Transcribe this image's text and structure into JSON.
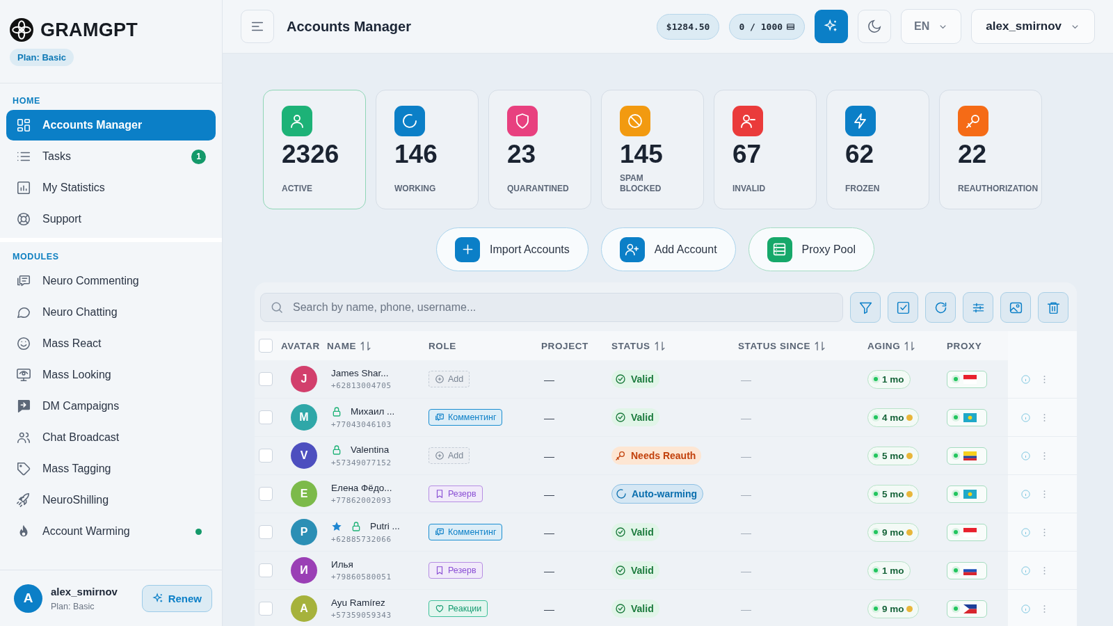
{
  "sidebar": {
    "logo": "GRAMGPT",
    "plan_badge": "Plan: Basic",
    "sections": [
      {
        "title": "HOME",
        "items": [
          {
            "label": "Accounts Manager",
            "kind": "grid",
            "selected": true
          },
          {
            "label": "Tasks",
            "kind": "list",
            "selected": false,
            "badge": "1"
          },
          {
            "label": "My Statistics",
            "kind": "chart",
            "selected": false
          },
          {
            "label": "Support",
            "kind": "lifebuoy",
            "selected": false
          }
        ]
      },
      {
        "title": "MODULES",
        "items": [
          {
            "label": "Neuro Commenting",
            "kind": "comment",
            "selected": false
          },
          {
            "label": "Neuro Chatting",
            "kind": "bubble",
            "selected": false
          },
          {
            "label": "Mass React",
            "kind": "smile",
            "selected": false
          },
          {
            "label": "Mass Looking",
            "kind": "monitor",
            "selected": false
          },
          {
            "label": "DM Campaigns",
            "kind": "dm",
            "selected": false
          },
          {
            "label": "Chat Broadcast",
            "kind": "users",
            "selected": false
          },
          {
            "label": "Mass Tagging",
            "kind": "tag",
            "selected": false
          },
          {
            "label": "NeuroShilling",
            "kind": "rocket",
            "selected": false
          },
          {
            "label": "Account Warming",
            "kind": "flame",
            "selected": false,
            "dot": true
          }
        ]
      }
    ],
    "user": {
      "avatar": "A",
      "name": "alex_smirnov",
      "plan": "Plan: Basic",
      "button": "Renew"
    }
  },
  "header": {
    "title": "Accounts Manager",
    "balance": "$1284.50",
    "credits": "0 / 1000",
    "language": "EN",
    "user": "alex_smirnov"
  },
  "stats": [
    {
      "value": "2326",
      "label": "ACTIVE",
      "kind": "user",
      "color": "#1db277",
      "selected": true
    },
    {
      "value": "146",
      "label": "WORKING",
      "kind": "spinner",
      "color": "#0b7fc7",
      "selected": false
    },
    {
      "value": "23",
      "label": "QUARANTINED",
      "kind": "shield",
      "color": "#e8407f",
      "selected": false
    },
    {
      "value": "145",
      "label": "SPAM BLOCKED",
      "kind": "ban",
      "color": "#f29a10",
      "selected": false
    },
    {
      "value": "67",
      "label": "INVALID",
      "kind": "userminus",
      "color": "#ea3b3b",
      "selected": false
    },
    {
      "value": "62",
      "label": "FROZEN",
      "kind": "bolt",
      "color": "#0b7fc7",
      "selected": false
    },
    {
      "value": "22",
      "label": "REAUTHORIZATION",
      "kind": "key",
      "color": "#f56b16",
      "selected": false
    }
  ],
  "actions": [
    {
      "label": "Import Accounts",
      "kind": "plus",
      "color": "#0b7fc7"
    },
    {
      "label": "Add Account",
      "kind": "userplus",
      "color": "#0b7fc7"
    },
    {
      "label": "Proxy Pool",
      "kind": "server",
      "color": "#16a86a"
    }
  ],
  "search": {
    "placeholder": "Search by name, phone, username..."
  },
  "table": {
    "select_all_checked": false,
    "columns": [
      {
        "label": "AVATAR",
        "sortable": false
      },
      {
        "label": "NAME",
        "sortable": true
      },
      {
        "label": "ROLE",
        "sortable": false
      },
      {
        "label": "PROJECT",
        "sortable": false
      },
      {
        "label": "STATUS",
        "sortable": true
      },
      {
        "label": "STATUS SINCE",
        "sortable": true
      },
      {
        "label": "AGING",
        "sortable": true
      },
      {
        "label": "PROXY",
        "sortable": false
      }
    ],
    "rows": [
      {
        "checked": false,
        "avatar": "J",
        "color": "#d23f6c",
        "name": "James Shar...",
        "phone": "+62813004705",
        "starred": false,
        "locked": false,
        "role": {
          "kind": "add",
          "label": "Add"
        },
        "project": "—",
        "status": {
          "kind": "valid",
          "label": "Valid"
        },
        "status_since": "—",
        "aging": "1 mo",
        "aging_warning": false,
        "proxy": {
          "kind": "id"
        }
      },
      {
        "checked": false,
        "avatar": "M",
        "color": "#2fa7a8",
        "name": "Михаил ...",
        "phone": "+77043046103",
        "starred": false,
        "locked": true,
        "role": {
          "kind": "commenting",
          "label": "Комментинг"
        },
        "project": "—",
        "status": {
          "kind": "valid",
          "label": "Valid"
        },
        "status_since": "—",
        "aging": "4 mo",
        "aging_warning": true,
        "proxy": {
          "kind": "kz"
        }
      },
      {
        "checked": false,
        "avatar": "V",
        "color": "#4d4fbf",
        "name": "Valentina",
        "phone": "+57349077152",
        "starred": false,
        "locked": true,
        "role": {
          "kind": "add",
          "label": "Add"
        },
        "project": "—",
        "status": {
          "kind": "reauth",
          "label": "Needs Reauth"
        },
        "status_since": "—",
        "aging": "5 mo",
        "aging_warning": true,
        "proxy": {
          "kind": "co"
        }
      },
      {
        "checked": false,
        "avatar": "E",
        "color": "#7cba4a",
        "name": "Елена Фёдо...",
        "phone": "+77862002093",
        "starred": false,
        "locked": false,
        "role": {
          "kind": "reserve",
          "label": "Резерв"
        },
        "project": "—",
        "status": {
          "kind": "warming",
          "label": "Auto-warming"
        },
        "status_since": "—",
        "aging": "5 mo",
        "aging_warning": true,
        "proxy": {
          "kind": "kz"
        }
      },
      {
        "checked": false,
        "avatar": "P",
        "color": "#2b8fb5",
        "name": "Putri ...",
        "phone": "+62885732066",
        "starred": true,
        "locked": true,
        "role": {
          "kind": "commenting",
          "label": "Комментинг"
        },
        "project": "—",
        "status": {
          "kind": "valid",
          "label": "Valid"
        },
        "status_since": "—",
        "aging": "9 mo",
        "aging_warning": true,
        "proxy": {
          "kind": "id"
        }
      },
      {
        "checked": false,
        "avatar": "И",
        "color": "#9a3fb5",
        "name": "Илья",
        "phone": "+79860580051",
        "starred": false,
        "locked": false,
        "role": {
          "kind": "reserve",
          "label": "Резерв"
        },
        "project": "—",
        "status": {
          "kind": "valid",
          "label": "Valid"
        },
        "status_since": "—",
        "aging": "1 mo",
        "aging_warning": false,
        "proxy": {
          "kind": "ru"
        }
      },
      {
        "checked": false,
        "avatar": "A",
        "color": "#a6b23c",
        "name": "Ayu Ramírez",
        "phone": "+57359059343",
        "starred": false,
        "locked": false,
        "role": {
          "kind": "reactions",
          "label": "Реакции"
        },
        "project": "—",
        "status": {
          "kind": "valid",
          "label": "Valid"
        },
        "status_since": "—",
        "aging": "9 mo",
        "aging_warning": true,
        "proxy": {
          "kind": "ph"
        }
      }
    ]
  }
}
